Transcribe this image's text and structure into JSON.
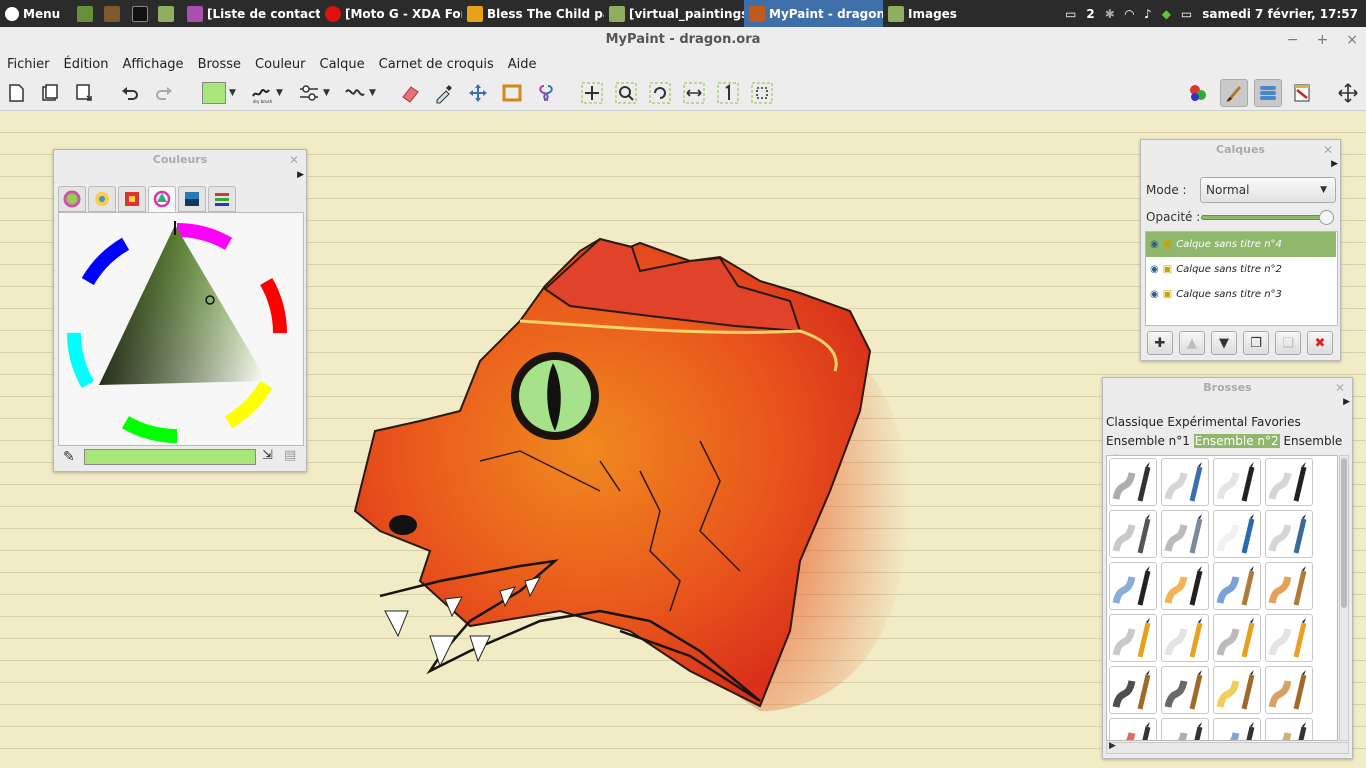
{
  "taskbar": {
    "menu_label": "Menu",
    "windows": [
      {
        "label": "[Liste de contacts]",
        "icon": "contacts-icon"
      },
      {
        "label": "[Moto G - XDA For...",
        "icon": "opera-icon"
      },
      {
        "label": "Bless The Child pa...",
        "icon": "bless-icon"
      },
      {
        "label": "[virtual_paintings",
        "icon": "folder-icon"
      },
      {
        "label": "MyPaint - dragon....",
        "icon": "mypaint-icon"
      },
      {
        "label": "Images",
        "icon": "folder-icon"
      }
    ],
    "notification_count": "2",
    "clock": "samedi  7 février, 17:57"
  },
  "window": {
    "title": "MyPaint - dragon.ora"
  },
  "menu": [
    "Fichier",
    "Édition",
    "Affichage",
    "Brosse",
    "Couleur",
    "Calque",
    "Carnet de croquis",
    "Aide"
  ],
  "toolbar": {
    "current_color": "#a8e67a",
    "brush_caption": "dry brush"
  },
  "colors_panel": {
    "title": "Couleurs",
    "current_color": "#a8e67a"
  },
  "layers_panel": {
    "title": "Calques",
    "mode_label": "Mode :",
    "mode_value": "Normal",
    "opacity_label": "Opacité :",
    "opacity": 1.0,
    "layers": [
      {
        "name": "Calque sans titre n°4",
        "selected": true
      },
      {
        "name": "Calque sans titre n°2",
        "selected": false
      },
      {
        "name": "Calque sans titre n°3",
        "selected": false
      }
    ]
  },
  "brushes_panel": {
    "title": "Brosses",
    "groups": [
      "Classique",
      "Expérimental",
      "Favories",
      "Ensemble n°1",
      "Ensemble n°2",
      "Ensemble n°"
    ],
    "selected_group": "Ensemble n°2"
  },
  "colors": {
    "accent": "#8fb86c",
    "taskbar_active": "#3f6fa8",
    "canvas": "#f1ebc6"
  }
}
